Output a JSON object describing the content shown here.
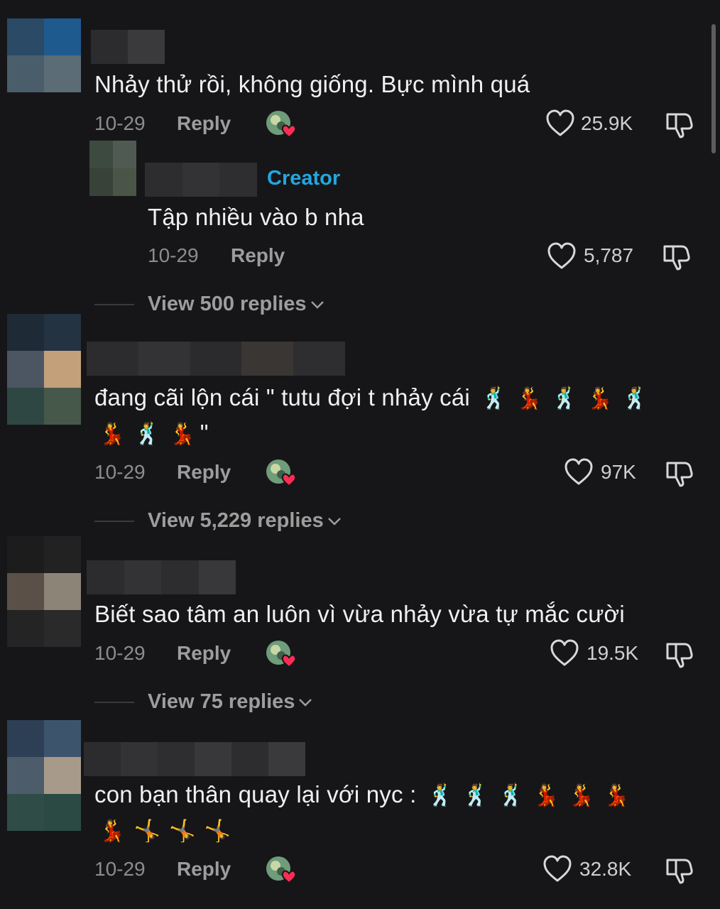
{
  "comments": [
    {
      "text": "Nhảy thử rồi, không giống. Bực mình quá",
      "date": "10-29",
      "reply_label": "Reply",
      "likes": "25.9K",
      "replies": [
        {
          "badge": "Creator",
          "text": "Tập nhiều vào b nha",
          "date": "10-29",
          "reply_label": "Reply",
          "likes": "5,787"
        }
      ],
      "view_replies": "View 500 replies"
    },
    {
      "text_line1": "đang cãi lộn cái \" tutu đợi t nhảy cái",
      "emoji_line1": [
        "man-dancing",
        "woman-dancing",
        "man-dancing",
        "woman-dancing",
        "man-dancing"
      ],
      "emoji_line2": [
        "woman-dancing",
        "man-dancing",
        "woman-dancing"
      ],
      "closing_quote": "\"",
      "date": "10-29",
      "reply_label": "Reply",
      "likes": "97K",
      "view_replies": "View 5,229 replies"
    },
    {
      "text": "Biết sao tâm an luôn vì vừa nhảy vừa tự mắc cười",
      "date": "10-29",
      "reply_label": "Reply",
      "likes": "19.5K",
      "view_replies": "View 75 replies"
    },
    {
      "text_line1": "con bạn thân quay lại với nyc :",
      "emoji_line1": [
        "man-dancing",
        "man-dancing",
        "man-dancing",
        "woman-dancing",
        "woman-dancing",
        "woman-dancing"
      ],
      "emoji_line2": [
        "woman-dancing",
        "cartwheel",
        "cartwheel",
        "cartwheel"
      ],
      "date": "10-29",
      "reply_label": "Reply",
      "likes": "32.8K"
    }
  ],
  "colors": {
    "background": "#161618",
    "creator_badge": "#22a7e0",
    "liked_heart": "#fe2c55"
  }
}
